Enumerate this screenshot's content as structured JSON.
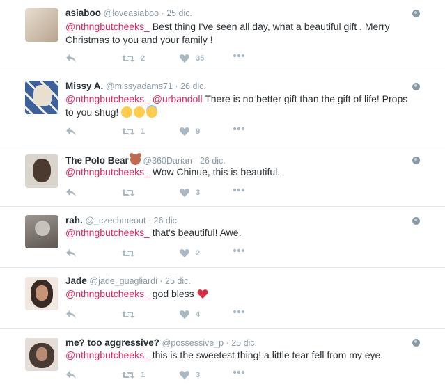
{
  "tweets": [
    {
      "name": "asiaboo",
      "handle": "@loveasiaboo · 25 dic.",
      "mention": "@nthngbutcheeks_",
      "text": " Best thing I've seen all day, what a beautiful gift . Merry Christmas to you and your family !",
      "retweets": "2",
      "likes": "35",
      "avatar_color": "#c9b59e"
    },
    {
      "name": "Missy A.",
      "handle": "@missyadams71 · 26 dic.",
      "mention": "@nthngbutcheeks_",
      "mention2": "@urbandoll",
      "text": " There is no better gift than the gift of life! Props to you shug! ",
      "emojis": [
        "relieved-face",
        "winking-kiss-face",
        "smiling-halo-face"
      ],
      "retweets": "1",
      "likes": "9",
      "avatar_color": "#4a6fa5"
    },
    {
      "name": "The Polo Bear",
      "handle": "@360Darian · 26 dic.",
      "mention": "@nthngbutcheeks_",
      "text": " Wow Chinue, this is beautiful.",
      "retweets": "",
      "likes": "3",
      "avatar_color": "#5b4a3f"
    },
    {
      "name": "rah.",
      "handle": "@_czechmeout · 26 dic.",
      "mention": "@nthngbutcheeks_",
      "text": " that's beautiful! Awe.",
      "retweets": "",
      "likes": "2",
      "avatar_color": "#7d7670"
    },
    {
      "name": "Jade",
      "handle": "@jade_guagliardi · 25 dic.",
      "mention": "@nthngbutcheeks_",
      "text": " god bless ",
      "retweets": "",
      "likes": "4",
      "avatar_color": "#8a5a44"
    },
    {
      "name": "me? too aggressive?",
      "handle": "@possessive_p · 25 dic.",
      "mention": "@nthngbutcheeks_",
      "text": " this is the sweetest thing! a little tear fell from my eye.",
      "retweets": "1",
      "likes": "3",
      "avatar_color": "#6b5a52"
    }
  ],
  "colors": {
    "mention": "#e0245e",
    "muted": "#8899a6",
    "icon": "#aab8c2",
    "heart": "#dd2e44"
  },
  "icons": [
    "reply-icon",
    "retweet-icon",
    "like-icon",
    "more-icon",
    "globe-icon"
  ]
}
